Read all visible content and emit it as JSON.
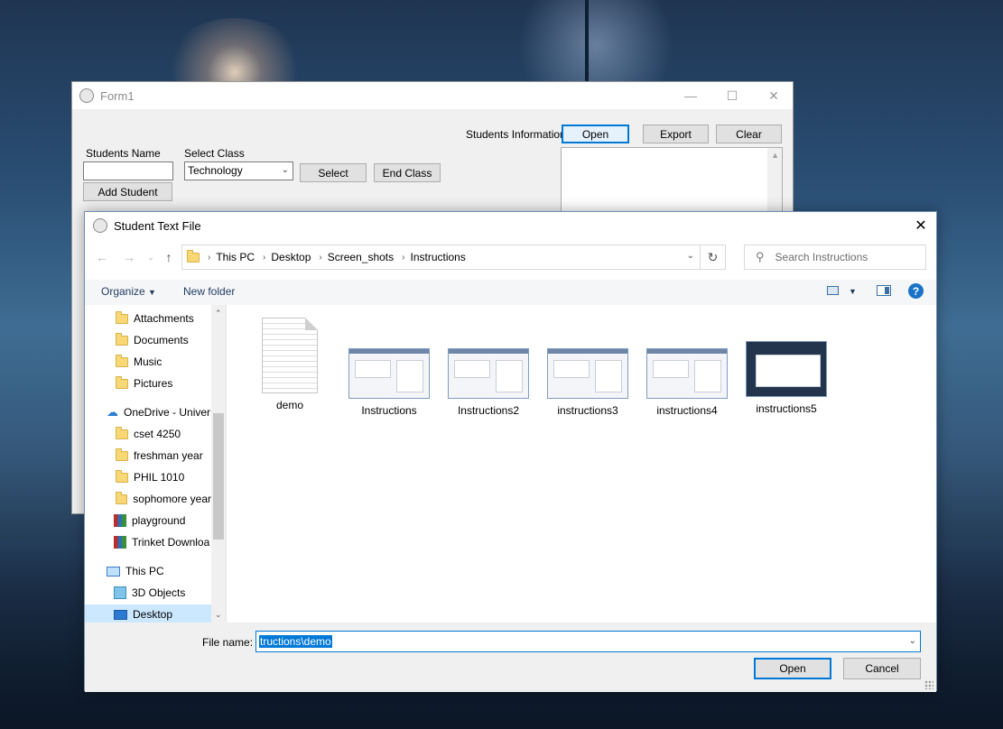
{
  "form1": {
    "title": "Form1",
    "students_name_label": "Students Name",
    "select_class_label": "Select Class",
    "class_value": "Technology",
    "select_button": "Select",
    "end_class_button": "End Class",
    "add_student_button": "Add Student",
    "students_info_label": "Students Information",
    "open_button": "Open",
    "export_button": "Export",
    "clear_button": "Clear"
  },
  "dialog": {
    "title": "Student Text File",
    "breadcrumb": [
      "This PC",
      "Desktop",
      "Screen_shots",
      "Instructions"
    ],
    "search_placeholder": "Search Instructions",
    "toolbar": {
      "organize": "Organize",
      "new_folder": "New folder"
    },
    "nav_items": [
      {
        "label": "Attachments",
        "icon": "folder-icon"
      },
      {
        "label": "Documents",
        "icon": "folder-icon"
      },
      {
        "label": "Music",
        "icon": "folder-icon"
      },
      {
        "label": "Pictures",
        "icon": "folder-icon"
      },
      {
        "label": "OneDrive - Univer",
        "icon": "cloud-icon"
      },
      {
        "label": "cset 4250",
        "icon": "folder-icon"
      },
      {
        "label": "freshman year",
        "icon": "folder-icon"
      },
      {
        "label": "PHIL 1010",
        "icon": "folder-icon"
      },
      {
        "label": "sophomore year",
        "icon": "folder-icon"
      },
      {
        "label": "playground",
        "icon": "archive-icon"
      },
      {
        "label": "Trinket Downloa",
        "icon": "archive-icon"
      },
      {
        "label": "This PC",
        "icon": "computer-icon"
      },
      {
        "label": "3D Objects",
        "icon": "cube-icon"
      },
      {
        "label": "Desktop",
        "icon": "desktop-icon"
      }
    ],
    "files": [
      {
        "name": "demo",
        "type": "text"
      },
      {
        "name": "Instructions",
        "type": "image"
      },
      {
        "name": "Instructions2",
        "type": "image"
      },
      {
        "name": "instructions3",
        "type": "image"
      },
      {
        "name": "instructions4",
        "type": "image"
      },
      {
        "name": "instructions5",
        "type": "image"
      }
    ],
    "file_name_label": "File name:",
    "file_name_value": "tructions\\demo",
    "open_button": "Open",
    "cancel_button": "Cancel"
  },
  "colors": {
    "accent": "#0078d7",
    "selection": "#cce8ff"
  }
}
